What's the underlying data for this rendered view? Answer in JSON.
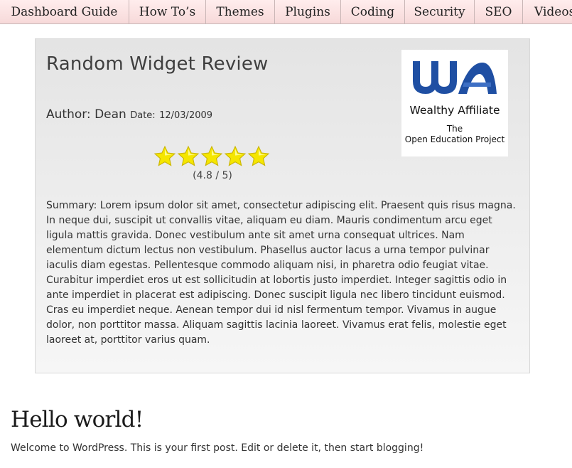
{
  "nav": {
    "items": [
      {
        "label": "Dashboard Guide"
      },
      {
        "label": "How To’s"
      },
      {
        "label": "Themes"
      },
      {
        "label": "Plugins"
      },
      {
        "label": "Coding"
      },
      {
        "label": "Security"
      },
      {
        "label": "SEO"
      },
      {
        "label": "Videos"
      }
    ]
  },
  "review": {
    "title": "Random Widget Review",
    "author_label": "Author:",
    "author_name": "Dean",
    "date_label": "Date:",
    "date": "12/03/2009",
    "rating": 4.8,
    "rating_max": 5,
    "rating_text": "(4.8 / 5)",
    "summary": "Summary: Lorem ipsum dolor sit amet, consectetur adipiscing elit. Praesent quis risus magna. In neque dui, suscipit ut convallis vitae, aliquam eu diam. Mauris condimentum arcu eget ligula mattis gravida. Donec vestibulum ante sit amet urna consequat ultrices. Nam elementum dictum lectus non vestibulum. Phasellus auctor lacus a urna tempor pulvinar iaculis diam egestas. Pellentesque commodo aliquam nisi, in pharetra odio feugiat vitae. Curabitur imperdiet eros ut est sollicitudin at lobortis justo imperdiet. Integer sagittis odio in ante imperdiet in placerat est adipiscing. Donec suscipit ligula nec libero tincidunt euismod. Cras eu imperdiet neque. Aenean tempor dui id nisl fermentum tempor. Vivamus in augue dolor, non porttitor massa. Aliquam sagittis lacinia laoreet. Vivamus erat felis, molestie eget laoreet at, porttitor varius quam.",
    "logo": {
      "brand": "Wealthy Affiliate",
      "tagline_1": "The",
      "tagline_2": "Open Education Project"
    }
  },
  "post": {
    "title": "Hello world!",
    "body": "Welcome to WordPress. This is your first post. Edit or delete it, then start blogging!"
  },
  "colors": {
    "nav_bg": "#fbe3e3",
    "logo_blue": "#1f4fa3",
    "star": "#f5e600"
  }
}
